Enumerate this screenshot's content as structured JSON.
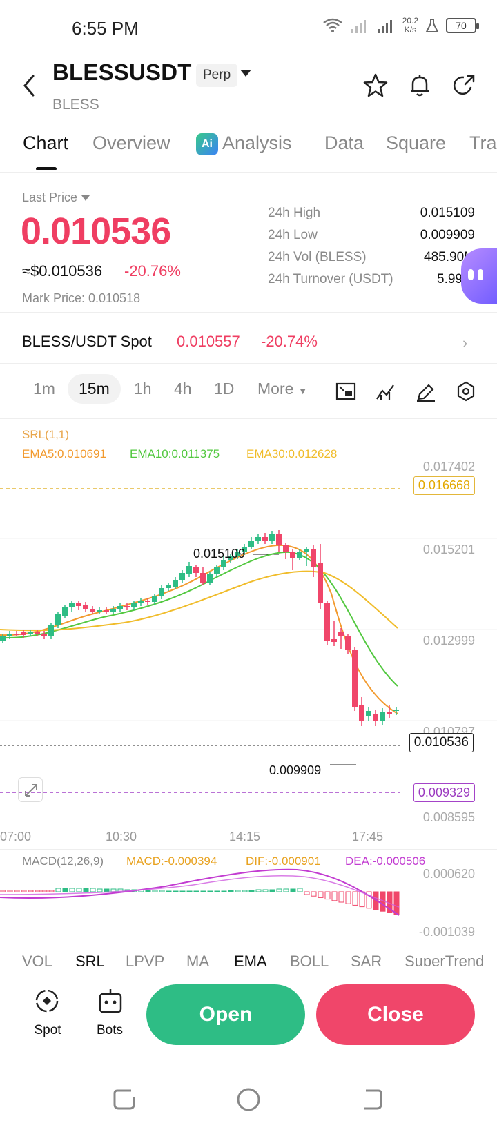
{
  "status": {
    "time": "6:55 PM",
    "speed_top": "20.2",
    "speed_bot": "K/s",
    "battery": "70"
  },
  "header": {
    "symbol": "BLESSUSDT",
    "badge": "Perp",
    "subtitle": "BLESS"
  },
  "tabs": [
    "Chart",
    "Overview",
    "Analysis",
    "Data",
    "Square",
    "Tra"
  ],
  "price": {
    "label": "Last Price",
    "value": "0.010536",
    "usd": "≈$0.010536",
    "change": "-20.76%",
    "mark": "Mark Price: 0.010518"
  },
  "stats": [
    {
      "label": "24h  High",
      "value": "0.015109"
    },
    {
      "label": "24h  Low",
      "value": "0.009909"
    },
    {
      "label": "24h  Vol (BLESS)",
      "value": "485.90M"
    },
    {
      "label": "24h  Turnover (USDT)",
      "value": "5.99"
    }
  ],
  "spot": {
    "label": "BLESS/USDT Spot",
    "price": "0.010557",
    "change": "-20.74%"
  },
  "timeframes": [
    "1m",
    "15m",
    "1h",
    "4h",
    "1D",
    "More"
  ],
  "indicators": {
    "srl": "SRL(1,1)",
    "ema5": "EMA5:0.010691",
    "ema10": "EMA10:0.011375",
    "ema30": "EMA30:0.012628",
    "macd_title": "MACD(12,26,9)",
    "macd": "MACD:-0.000394",
    "dif": "DIF:-0.000901",
    "dea": "DEA:-0.000506"
  },
  "chart_data": {
    "type": "candlestick",
    "y_ticks": [
      "0.017402",
      "0.015201",
      "0.012999",
      "0.010797",
      "0.008595"
    ],
    "x_ticks": [
      "07:00",
      "10:30",
      "14:15",
      "17:45"
    ],
    "high_label": "0.015109",
    "low_label": "0.009909",
    "level_upper": "0.016668",
    "current": "0.010536",
    "level_lower": "0.009329",
    "macd_ticks": [
      "0.000620",
      "-0.001039"
    ],
    "colors": {
      "up": "#2ebd85",
      "down": "#f0466a",
      "ema5": "#f29a2e",
      "ema10": "#52c83f",
      "ema30": "#f0bc2a",
      "dif": "#e8a220",
      "dea": "#c23bd1"
    }
  },
  "bottom_tabs": [
    "VOL",
    "SRL",
    "LPVP",
    "MA",
    "EMA",
    "BOLL",
    "SAR",
    "SuperTrend"
  ],
  "actions": {
    "spot": "Spot",
    "bots": "Bots",
    "open": "Open",
    "close": "Close"
  }
}
